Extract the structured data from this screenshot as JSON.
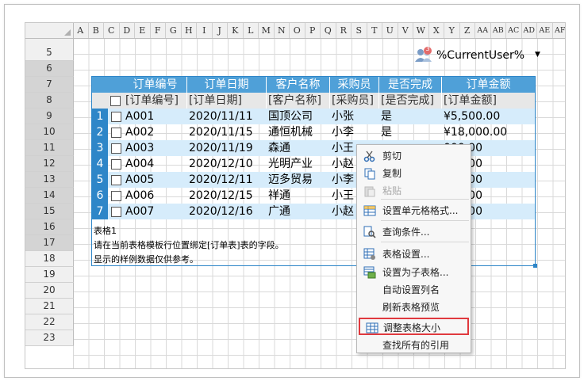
{
  "columns": [
    "A",
    "B",
    "C",
    "D",
    "E",
    "F",
    "G",
    "H",
    "I",
    "J",
    "K",
    "L",
    "M",
    "N",
    "O",
    "P",
    "Q",
    "R",
    "S",
    "T",
    "U",
    "V",
    "W",
    "X",
    "Y",
    "Z",
    "AA",
    "AB",
    "AC",
    "AD",
    "AE",
    "AF"
  ],
  "rows": [
    "4",
    "5",
    "6",
    "7",
    "8",
    "9",
    "10",
    "11",
    "12",
    "13",
    "14",
    "15",
    "16",
    "17",
    "18",
    "19",
    "20",
    "21",
    "22",
    "23"
  ],
  "user": {
    "badge": "3",
    "label": "%CurrentUser%",
    "dropdown": "▼"
  },
  "table": {
    "headers": [
      "订单编号",
      "订单日期",
      "客户名称",
      "采购员",
      "是否完成",
      "订单金额"
    ],
    "templates": [
      "[订单编号]",
      "[订单日期]",
      "[客户名称]",
      "[采购员]",
      "[是否完成]",
      "[订单金额]"
    ],
    "rows": [
      {
        "n": "1",
        "id": "A001",
        "date": "2020/11/11",
        "customer": "国顶公司",
        "buyer": "小张",
        "done": "是",
        "amount": "¥5,500.00"
      },
      {
        "n": "2",
        "id": "A002",
        "date": "2020/11/15",
        "customer": "通恒机械",
        "buyer": "小李",
        "done": "是",
        "amount": "¥18,000.00"
      },
      {
        "n": "3",
        "id": "A003",
        "date": "2020/11/19",
        "customer": "森通",
        "buyer": "小王",
        "done": "",
        "amount": "000.00"
      },
      {
        "n": "4",
        "id": "A004",
        "date": "2020/12/10",
        "customer": "光明产业",
        "buyer": "小赵",
        "done": "",
        "amount": "000.00"
      },
      {
        "n": "5",
        "id": "A005",
        "date": "2020/12/11",
        "customer": "迈多贸易",
        "buyer": "小李",
        "done": "",
        "amount": "000.00"
      },
      {
        "n": "6",
        "id": "A006",
        "date": "2020/12/15",
        "customer": "祥通",
        "buyer": "小王",
        "done": "",
        "amount": "000.00"
      },
      {
        "n": "7",
        "id": "A007",
        "date": "2020/12/16",
        "customer": "广通",
        "buyer": "小赵",
        "done": "",
        "amount": "000.00"
      }
    ],
    "footer": [
      "表格1",
      "请在当前表格模板行位置绑定[订单表]表的字段。",
      "显示的样例数据仅供参考。"
    ]
  },
  "menu": [
    {
      "label": "剪切",
      "icon": "scissors-icon",
      "enabled": true
    },
    {
      "label": "复制",
      "icon": "copy-icon",
      "enabled": true
    },
    {
      "label": "粘贴",
      "icon": "paste-icon",
      "enabled": false
    },
    {
      "label": "设置单元格格式...",
      "icon": "format-cells-icon",
      "enabled": true
    },
    {
      "label": "查询条件...",
      "icon": "query-icon",
      "enabled": true
    },
    {
      "label": "表格设置...",
      "icon": "table-settings-icon",
      "enabled": true
    },
    {
      "label": "设置为子表格...",
      "icon": "subtable-icon",
      "enabled": true
    },
    {
      "label": "自动设置列名",
      "icon": "",
      "enabled": true
    },
    {
      "label": "刷新表格预览",
      "icon": "",
      "enabled": true
    },
    {
      "label": "调整表格大小",
      "icon": "resize-table-icon",
      "enabled": true,
      "highlighted": true
    },
    {
      "label": "查找所有的引用",
      "icon": "",
      "enabled": true
    }
  ],
  "colors": {
    "accent": "#2e86c8",
    "header": "#4fa0d8",
    "rowAlt": "#d6ecfb",
    "highlight": "#e0393e"
  }
}
